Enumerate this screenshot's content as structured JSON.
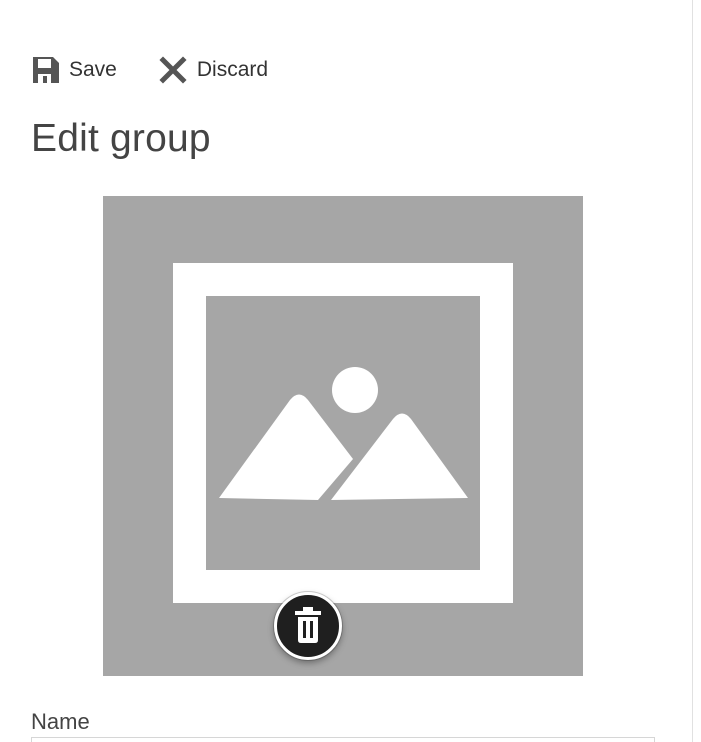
{
  "toolbar": {
    "save": {
      "label": "Save",
      "icon": "save-icon"
    },
    "discard": {
      "label": "Discard",
      "icon": "close-icon"
    }
  },
  "page": {
    "title": "Edit group"
  },
  "group_photo": {
    "placeholder_icon": "image-placeholder-icon",
    "delete_icon": "trash-icon",
    "background_color": "#a6a6a6"
  },
  "form": {
    "name": {
      "label": "Name",
      "value": ""
    }
  },
  "colors": {
    "text": "#333333",
    "title": "#444444",
    "icon": "#555555",
    "photo_background": "#a6a6a6",
    "delete_button": "#1f1f1f"
  }
}
